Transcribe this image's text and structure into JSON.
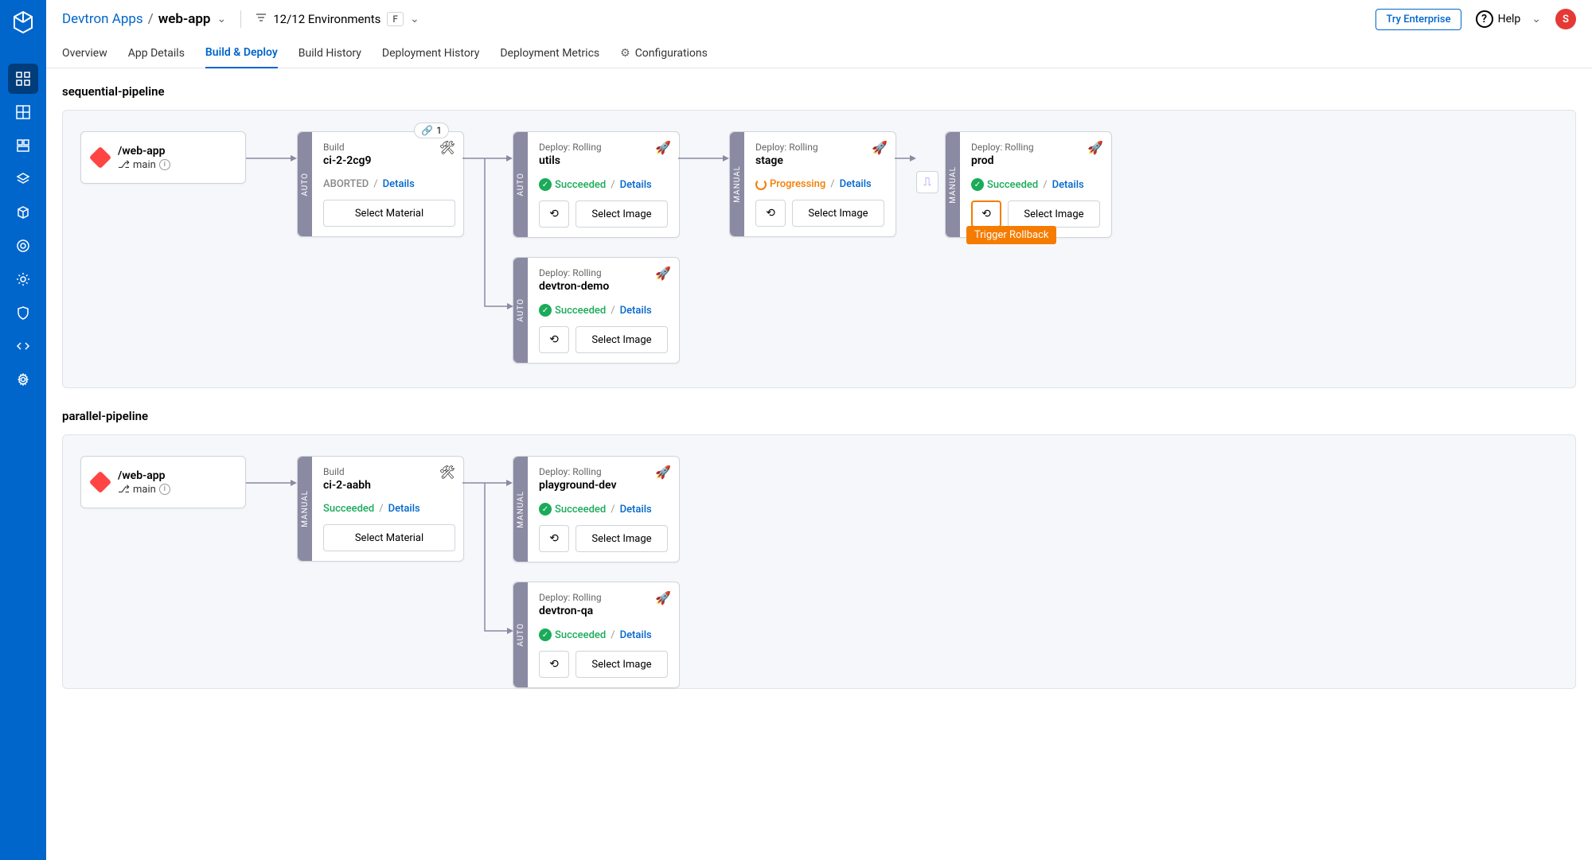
{
  "header": {
    "breadcrumb_parent": "Devtron Apps",
    "breadcrumb_current": "web-app",
    "env_filter": "12/12 Environments",
    "kbd": "F",
    "try_enterprise": "Try Enterprise",
    "help": "Help",
    "avatar": "S"
  },
  "tabs": [
    "Overview",
    "App Details",
    "Build & Deploy",
    "Build History",
    "Deployment History",
    "Deployment Metrics",
    "Configurations"
  ],
  "active_tab": "Build & Deploy",
  "buttons": {
    "select_material": "Select Material",
    "select_image": "Select Image",
    "details": "Details"
  },
  "labels": {
    "build": "Build",
    "deploy_rolling": "Deploy: Rolling",
    "auto": "AUTO",
    "manual": "MANUAL",
    "aborted": "ABORTED",
    "succeeded": "Succeeded",
    "progressing": "Progressing",
    "trigger_rollback": "Trigger Rollback",
    "branch": "main",
    "link_count": "1"
  },
  "pipelines": [
    {
      "title": "sequential-pipeline",
      "source": {
        "name": "/web-app"
      },
      "build": {
        "name": "ci-2-2cg9",
        "status": "ABORTED",
        "mode": "AUTO",
        "linked": true
      },
      "deploys": [
        {
          "name": "utils",
          "status": "Succeeded",
          "mode": "AUTO"
        },
        {
          "name": "devtron-demo",
          "status": "Succeeded",
          "mode": "AUTO"
        },
        {
          "name": "stage",
          "status": "Progressing",
          "mode": "MANUAL"
        },
        {
          "name": "prod",
          "status": "Succeeded",
          "mode": "MANUAL",
          "highlight": true
        }
      ]
    },
    {
      "title": "parallel-pipeline",
      "source": {
        "name": "/web-app"
      },
      "build": {
        "name": "ci-2-aabh",
        "status": "Succeeded",
        "mode": "MANUAL"
      },
      "deploys": [
        {
          "name": "playground-dev",
          "status": "Succeeded",
          "mode": "MANUAL"
        },
        {
          "name": "devtron-qa",
          "status": "Succeeded",
          "mode": "AUTO"
        }
      ]
    }
  ]
}
